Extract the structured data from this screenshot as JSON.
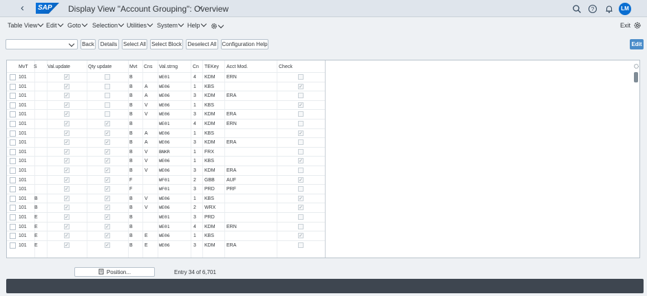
{
  "shell": {
    "title": "Display View \"Account Grouping\": Overview",
    "logo": "SAP",
    "avatar": "LM",
    "icons": [
      "back-icon",
      "search-icon",
      "help-icon",
      "bell-icon"
    ]
  },
  "menu": {
    "items": [
      "Table View",
      "Edit",
      "Goto",
      "Selection",
      "Utilities",
      "System",
      "Help"
    ],
    "exit_label": "Exit"
  },
  "toolbar": {
    "dropdown_value": "",
    "buttons": [
      "Back",
      "Details",
      "Select All",
      "Select Block",
      "Deselect All",
      "Configuration Help"
    ],
    "edit_label": "Edit"
  },
  "table": {
    "headers": [
      "MvT",
      "S",
      "Val.update",
      "Qty update",
      "Mvt",
      "Cns",
      "Val.strng",
      "Cn",
      "TEKey",
      "Acct Mod.",
      "Check"
    ],
    "rows": [
      {
        "mvt": "101",
        "s": "",
        "val": true,
        "qty": false,
        "mv": "B",
        "cns": "",
        "vs": "WE01",
        "cn": "4",
        "tek": "KDM",
        "acct": "ERN",
        "chk": false
      },
      {
        "mvt": "101",
        "s": "",
        "val": true,
        "qty": false,
        "mv": "B",
        "cns": "A",
        "vs": "WE06",
        "cn": "1",
        "tek": "KBS",
        "acct": "",
        "chk": true
      },
      {
        "mvt": "101",
        "s": "",
        "val": true,
        "qty": false,
        "mv": "B",
        "cns": "A",
        "vs": "WE06",
        "cn": "3",
        "tek": "KDM",
        "acct": "ERA",
        "chk": false
      },
      {
        "mvt": "101",
        "s": "",
        "val": true,
        "qty": false,
        "mv": "B",
        "cns": "V",
        "vs": "WE06",
        "cn": "1",
        "tek": "KBS",
        "acct": "",
        "chk": true
      },
      {
        "mvt": "101",
        "s": "",
        "val": true,
        "qty": false,
        "mv": "B",
        "cns": "V",
        "vs": "WE06",
        "cn": "3",
        "tek": "KDM",
        "acct": "ERA",
        "chk": false
      },
      {
        "mvt": "101",
        "s": "",
        "val": true,
        "qty": true,
        "mv": "B",
        "cns": "",
        "vs": "WE01",
        "cn": "4",
        "tek": "KDM",
        "acct": "ERN",
        "chk": false
      },
      {
        "mvt": "101",
        "s": "",
        "val": true,
        "qty": true,
        "mv": "B",
        "cns": "A",
        "vs": "WE06",
        "cn": "1",
        "tek": "KBS",
        "acct": "",
        "chk": true
      },
      {
        "mvt": "101",
        "s": "",
        "val": true,
        "qty": true,
        "mv": "B",
        "cns": "A",
        "vs": "WE06",
        "cn": "3",
        "tek": "KDM",
        "acct": "ERA",
        "chk": false
      },
      {
        "mvt": "101",
        "s": "",
        "val": true,
        "qty": true,
        "mv": "B",
        "cns": "V",
        "vs": "BNKR",
        "cn": "1",
        "tek": "FRX",
        "acct": "",
        "chk": false
      },
      {
        "mvt": "101",
        "s": "",
        "val": true,
        "qty": true,
        "mv": "B",
        "cns": "V",
        "vs": "WE06",
        "cn": "1",
        "tek": "KBS",
        "acct": "",
        "chk": true
      },
      {
        "mvt": "101",
        "s": "",
        "val": true,
        "qty": true,
        "mv": "B",
        "cns": "V",
        "vs": "WE06",
        "cn": "3",
        "tek": "KDM",
        "acct": "ERA",
        "chk": false
      },
      {
        "mvt": "101",
        "s": "",
        "val": true,
        "qty": true,
        "mv": "F",
        "cns": "",
        "vs": "WF01",
        "cn": "2",
        "tek": "GBB",
        "acct": "AUF",
        "chk": true
      },
      {
        "mvt": "101",
        "s": "",
        "val": true,
        "qty": true,
        "mv": "F",
        "cns": "",
        "vs": "WF01",
        "cn": "3",
        "tek": "PRD",
        "acct": "PRF",
        "chk": false
      },
      {
        "mvt": "101",
        "s": "B",
        "val": true,
        "qty": true,
        "mv": "B",
        "cns": "V",
        "vs": "WE06",
        "cn": "1",
        "tek": "KBS",
        "acct": "",
        "chk": true
      },
      {
        "mvt": "101",
        "s": "B",
        "val": true,
        "qty": true,
        "mv": "B",
        "cns": "V",
        "vs": "WE06",
        "cn": "2",
        "tek": "WRX",
        "acct": "",
        "chk": true
      },
      {
        "mvt": "101",
        "s": "E",
        "val": true,
        "qty": true,
        "mv": "B",
        "cns": "",
        "vs": "WE01",
        "cn": "3",
        "tek": "PRD",
        "acct": "",
        "chk": false
      },
      {
        "mvt": "101",
        "s": "E",
        "val": true,
        "qty": true,
        "mv": "B",
        "cns": "",
        "vs": "WE01",
        "cn": "4",
        "tek": "KDM",
        "acct": "ERN",
        "chk": false
      },
      {
        "mvt": "101",
        "s": "E",
        "val": true,
        "qty": true,
        "mv": "B",
        "cns": "E",
        "vs": "WE06",
        "cn": "1",
        "tek": "KBS",
        "acct": "",
        "chk": true
      },
      {
        "mvt": "101",
        "s": "E",
        "val": true,
        "qty": true,
        "mv": "B",
        "cns": "E",
        "vs": "WE06",
        "cn": "3",
        "tek": "KDM",
        "acct": "ERA",
        "chk": false
      }
    ]
  },
  "footer": {
    "position_label": "Position...",
    "entry_text": "Entry 34 of 6,701"
  },
  "colors": {
    "shell_bg": "#dfe5ec",
    "accent": "#0a6ed1",
    "edit_button": "#4a8cc9",
    "status_bar": "#3e4650"
  }
}
